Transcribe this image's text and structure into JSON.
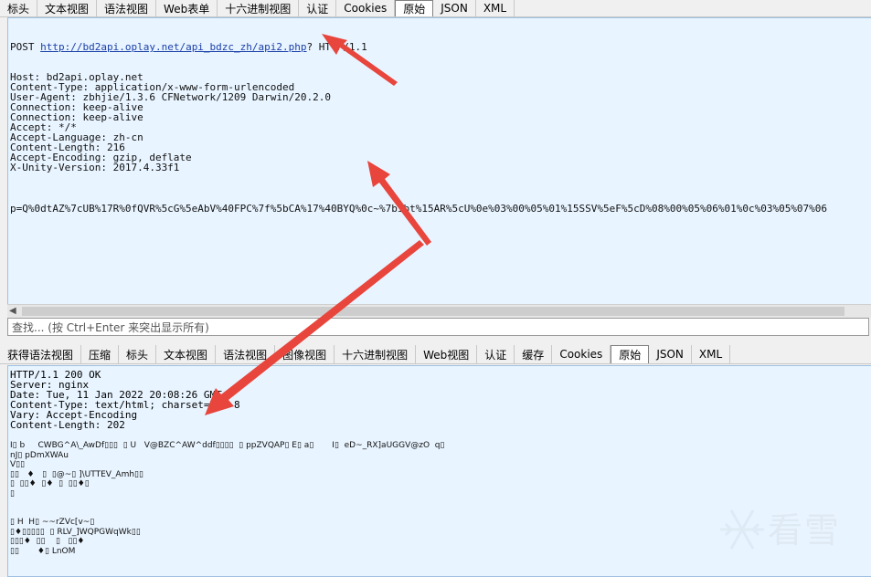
{
  "top_tabs": [
    "标头",
    "文本视图",
    "语法视图",
    "Web表单",
    "十六进制视图",
    "认证",
    "Cookies",
    "原始",
    "JSON",
    "XML"
  ],
  "top_active_tab": "原始",
  "request": {
    "method": "POST",
    "url": "http://bd2api.oplay.net/api_bdzc_zh/api2.php",
    "protocol": "? HTTP/1.1",
    "headers": [
      "Host: bd2api.oplay.net",
      "Content-Type: application/x-www-form-urlencoded",
      "User-Agent: zbhjie/1.3.6 CFNetwork/1209 Darwin/20.2.0",
      "Connection: keep-alive",
      "Connection: keep-alive",
      "Accept: */*",
      "Accept-Language: zh-cn",
      "Content-Length: 216",
      "Accept-Encoding: gzip, deflate",
      "X-Unity-Version: 2017.4.33f1"
    ],
    "body": "p=Q%0dtAZ%7cUB%17R%0fQVR%5cG%5eAbV%40FPC%7f%5bCA%17%40BYQ%0c~%7bibt%15AR%5cU%0e%03%00%05%01%15SSV%5eF%5cD%08%00%05%06%01%0c%03%05%07%06"
  },
  "find_bar_placeholder": "查找... (按 Ctrl+Enter 来突出显示所有)",
  "bottom_tabs": [
    "获得语法视图",
    "压缩",
    "标头",
    "文本视图",
    "语法视图",
    "图像视图",
    "十六进制视图",
    "Web视图",
    "认证",
    "缓存",
    "Cookies",
    "原始",
    "JSON",
    "XML"
  ],
  "bottom_active_tab": "原始",
  "response": {
    "headers": [
      "HTTP/1.1 200 OK",
      "Server: nginx",
      "Date: Tue, 11 Jan 2022 20:08:26 GMT",
      "Content-Type: text/html; charset=UTF-8",
      "Vary: Accept-Encoding",
      "Content-Length: 202"
    ],
    "body_lines": [
      "I▯ b     CWBG^A\\_AwDf▯▯▯  ▯ U   V@BZC^AW^ddf▯▯▯▯  ▯ ppZVQAP▯ E▯ a▯       I▯  eD~_RX]aUGGV@zO  q▯",
      "nJ▯ pDmXWAu",
      "V▯▯",
      "▯▯   ♦   ▯  ▯@~▯ ]\\UTTEV_Amh▯▯",
      "▯  ▯▯♦  ▯♦  ▯  ▯▯♦▯",
      "▯",
      "",
      "",
      "▯ H  H▯ ~~rZVc[v~▯",
      "▯♦▯▯▯▯▯  ▯ RLV_]WQPGWqWk▯▯",
      "▯▯▯♦  ▯▯    ▯   ▯▯♦",
      "▯▯       ♦▯ LnOM"
    ]
  },
  "watermark_text": "看雪",
  "colors": {
    "pane_bg": "#e8f4ff",
    "arrow": "#e8453c",
    "url": "#1a3fa8"
  }
}
